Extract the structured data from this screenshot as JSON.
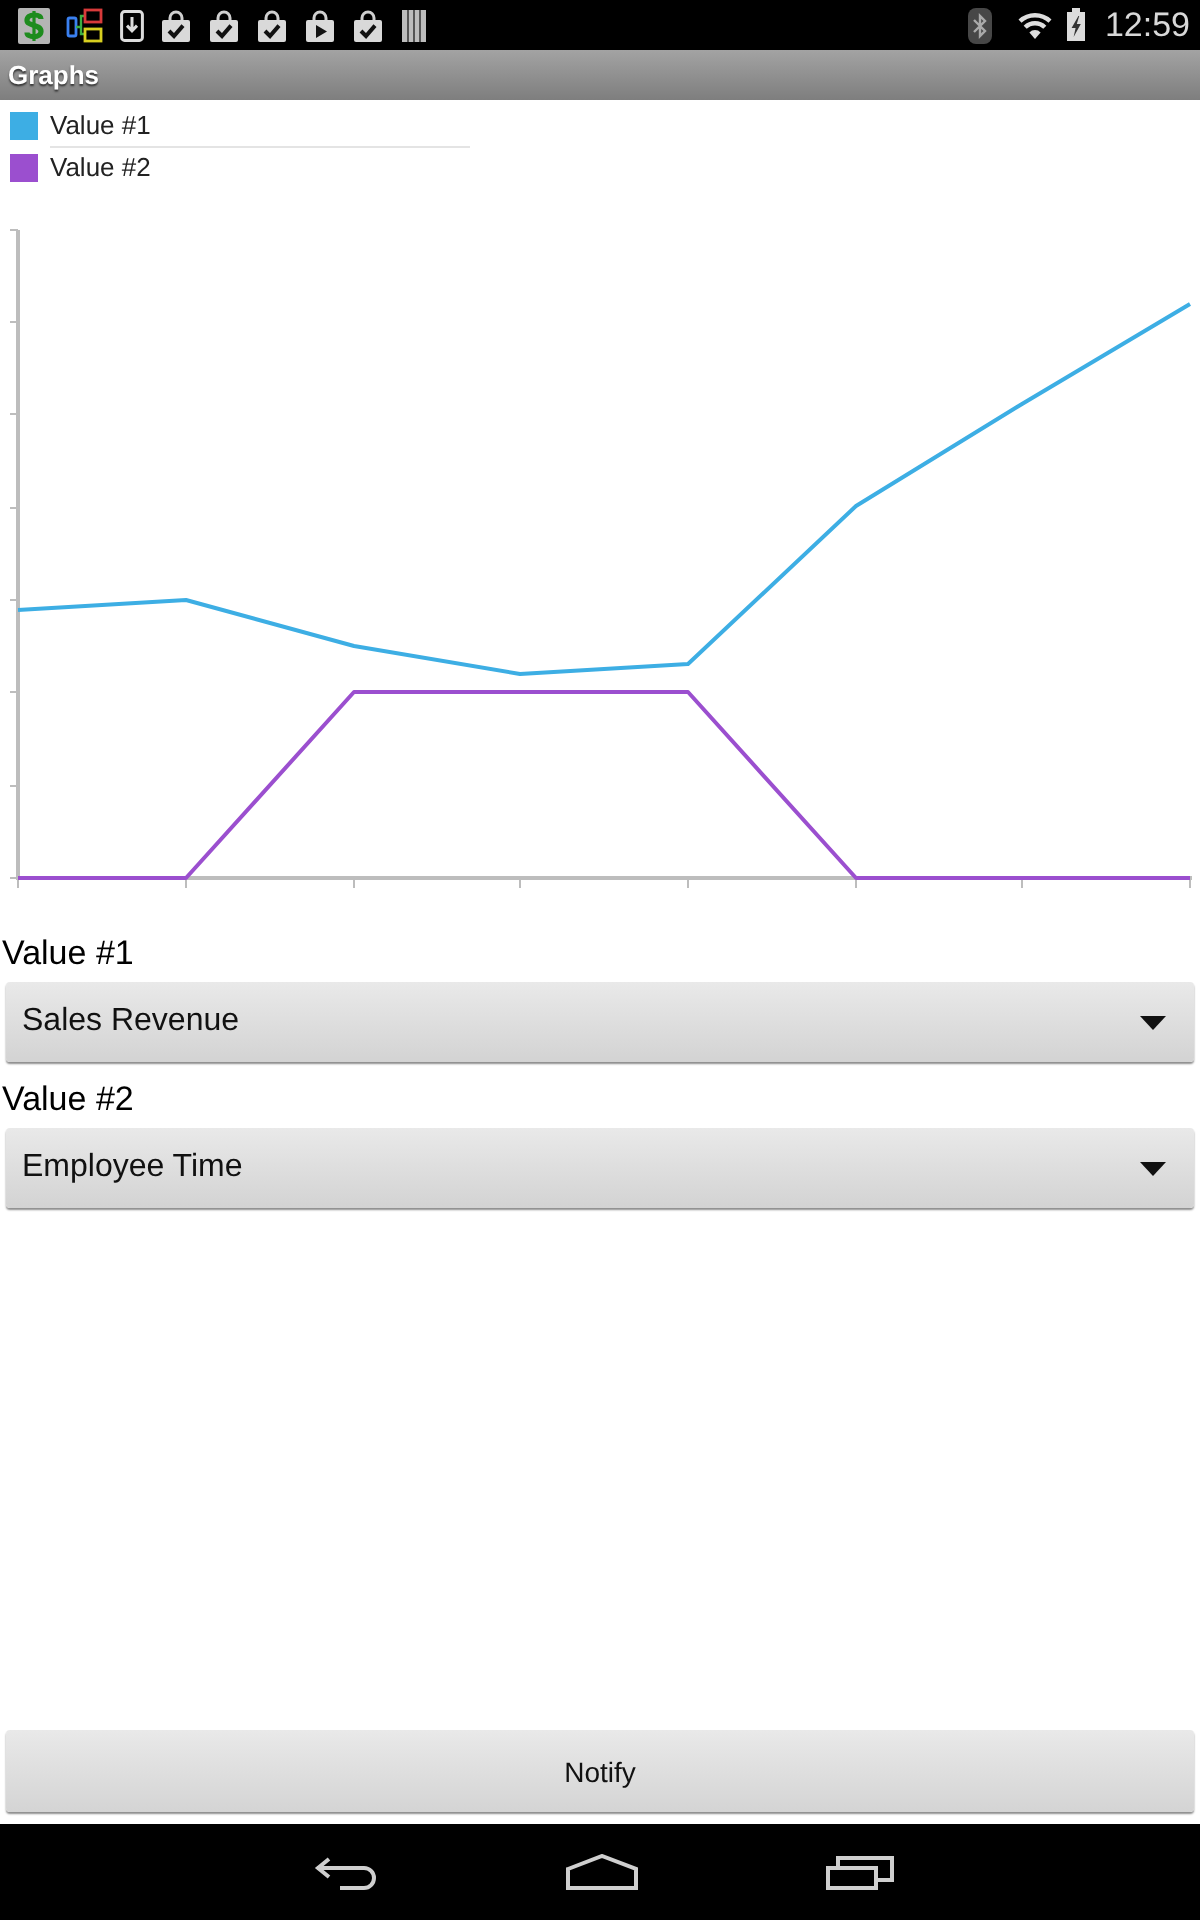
{
  "status_bar": {
    "time": "12:59"
  },
  "title_bar": {
    "title": "Graphs"
  },
  "legend": [
    {
      "label": "Value #1",
      "color": "#3daee4"
    },
    {
      "label": "Value #2",
      "color": "#9b4fcf"
    }
  ],
  "selectors": [
    {
      "label": "Value #1",
      "value": "Sales Revenue"
    },
    {
      "label": "Value #2",
      "value": "Employee Time"
    }
  ],
  "buttons": [
    {
      "label": "Notify"
    }
  ]
}
